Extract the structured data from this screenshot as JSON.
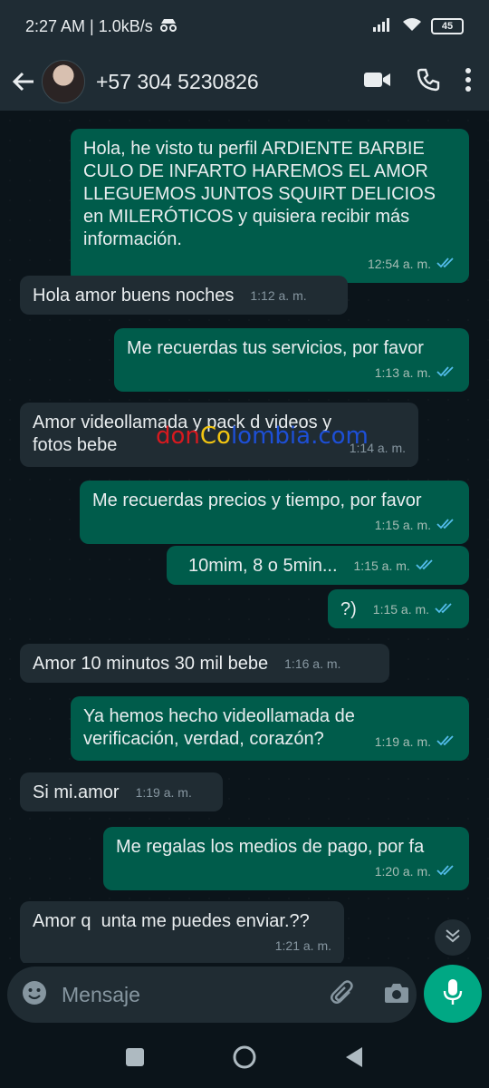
{
  "status": {
    "time_speed": "2:27 AM | 1.0kB/s",
    "battery": "45"
  },
  "header": {
    "contact_name": "+57 304 5230826"
  },
  "messages": [
    {
      "dir": "out",
      "text": "Hola, he visto tu perfil ARDIENTE BARBIE\nCULO DE INFARTO HAREMOS EL AMOR\nLLEGUEMOS JUNTOS SQUIRT DELICIOS\nen MILERÓTICOS y quisiera recibir más\ninformación.",
      "time": "12:54 a. m."
    },
    {
      "dir": "in",
      "text": "Hola amor buens noches",
      "time": "1:12 a. m."
    },
    {
      "dir": "out",
      "text": "Me recuerdas tus servicios, por favor",
      "time": "1:13 a. m."
    },
    {
      "dir": "in",
      "text": "Amor videollamada y pack d videos y\nfotos bebe",
      "time": "1:14 a. m."
    },
    {
      "dir": "out",
      "text": "Me recuerdas precios y tiempo, por favor",
      "time": "1:15 a. m."
    },
    {
      "dir": "out",
      "text": "10mim, 8 o 5min...",
      "time": "1:15 a. m."
    },
    {
      "dir": "out",
      "text": "?)",
      "time": "1:15 a. m."
    },
    {
      "dir": "in",
      "text": "Amor 10 minutos 30 mil bebe",
      "time": "1:16 a. m."
    },
    {
      "dir": "out",
      "text": "Ya hemos hecho videollamada de\nverificación, verdad, corazón?",
      "time": "1:19 a. m."
    },
    {
      "dir": "in",
      "text": "Si mi.amor",
      "time": "1:19 a. m."
    },
    {
      "dir": "out",
      "text": "Me regalas los medios de pago, por fa",
      "time": "1:20 a. m."
    },
    {
      "dir": "in",
      "text": "Amor q  unta me puedes enviar.??",
      "time": "1:21 a. m."
    }
  ],
  "watermark": {
    "part1": "don",
    "part2": "Co",
    "part3": "lombia.com"
  },
  "composer": {
    "placeholder": "Mensaje"
  },
  "colors": {
    "outgoing_bubble": "#005c4b",
    "incoming_bubble": "#202c33",
    "read_ticks": "#53bdeb",
    "accent_green": "#00a884"
  },
  "icons": [
    "back-arrow-icon",
    "video-call-icon",
    "phone-icon",
    "more-options-icon",
    "emoji-icon",
    "attach-icon",
    "camera-icon",
    "mic-icon",
    "scroll-down-icon",
    "double-check-icon"
  ]
}
